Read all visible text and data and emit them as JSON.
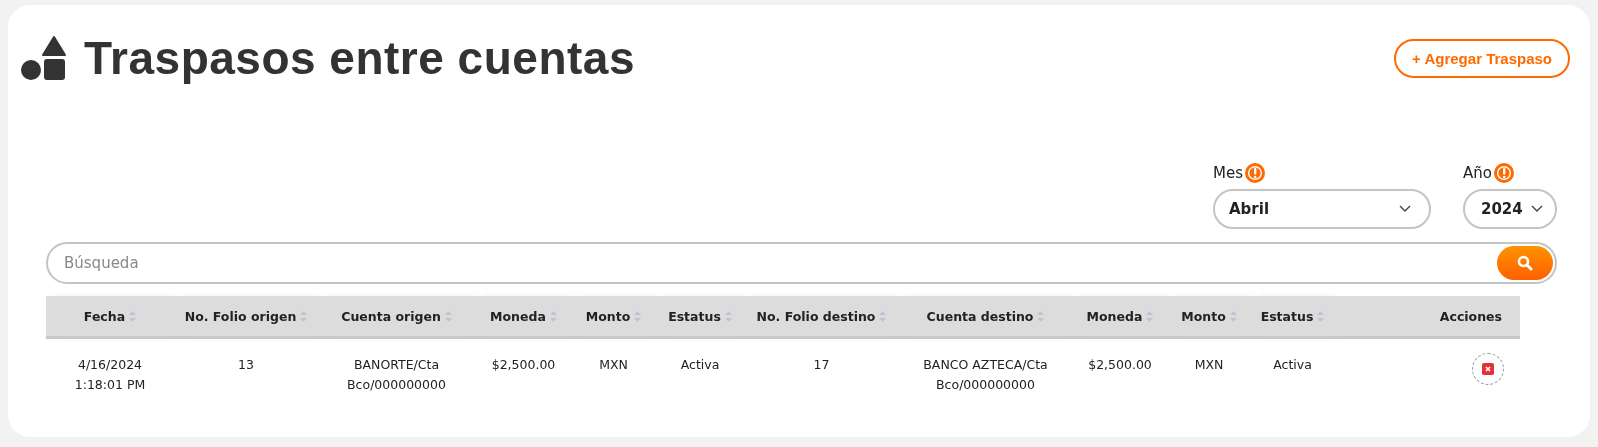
{
  "page": {
    "title": "Traspasos entre cuentas",
    "add_button": "+ Agregar Traspaso"
  },
  "filters": [
    {
      "label": "Mes",
      "value": "Abril",
      "kind": "wide"
    },
    {
      "label": "Año",
      "value": "2024",
      "kind": "narrow"
    }
  ],
  "search": {
    "placeholder": "Búsqueda"
  },
  "table": {
    "columns": [
      {
        "label": "Fecha",
        "sortable": true
      },
      {
        "label": "No. Folio origen",
        "sortable": true
      },
      {
        "label": "Cuenta origen",
        "sortable": true
      },
      {
        "label": "Moneda",
        "sortable": true
      },
      {
        "label": "Monto",
        "sortable": true
      },
      {
        "label": "Estatus",
        "sortable": true
      },
      {
        "label": "No. Folio destino",
        "sortable": true
      },
      {
        "label": "Cuenta destino",
        "sortable": true
      },
      {
        "label": "Moneda",
        "sortable": true
      },
      {
        "label": "Monto",
        "sortable": true
      },
      {
        "label": "Estatus",
        "sortable": true
      },
      {
        "label": "Acciones",
        "sortable": false
      }
    ],
    "rows": [
      {
        "cells": [
          "4/16/2024 1:18:01 PM",
          "13",
          "BANORTE/Cta Bco/000000000",
          "$2,500.00",
          "MXN",
          "Activa",
          "17",
          "BANCO AZTECA/Cta Bco/000000000",
          "$2,500.00",
          "MXN",
          "Activa"
        ],
        "can_delete": true
      }
    ]
  }
}
